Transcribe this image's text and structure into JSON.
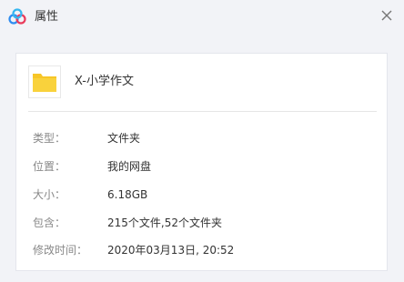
{
  "window": {
    "title": "属性",
    "app_icon": "baidu-netdisk-icon",
    "close_icon": "close-icon"
  },
  "file": {
    "icon": "folder-icon",
    "icon_color": "#f7c627",
    "name": "X-小学作文"
  },
  "properties": [
    {
      "label": "类型：",
      "value": "文件夹"
    },
    {
      "label": "位置：",
      "value": "我的网盘"
    },
    {
      "label": "大小：",
      "value": "6.18GB"
    },
    {
      "label": "包含：",
      "value": "215个文件,52个文件夹"
    },
    {
      "label": "修改时间：",
      "value": "2020年03月13日, 20:52"
    }
  ]
}
